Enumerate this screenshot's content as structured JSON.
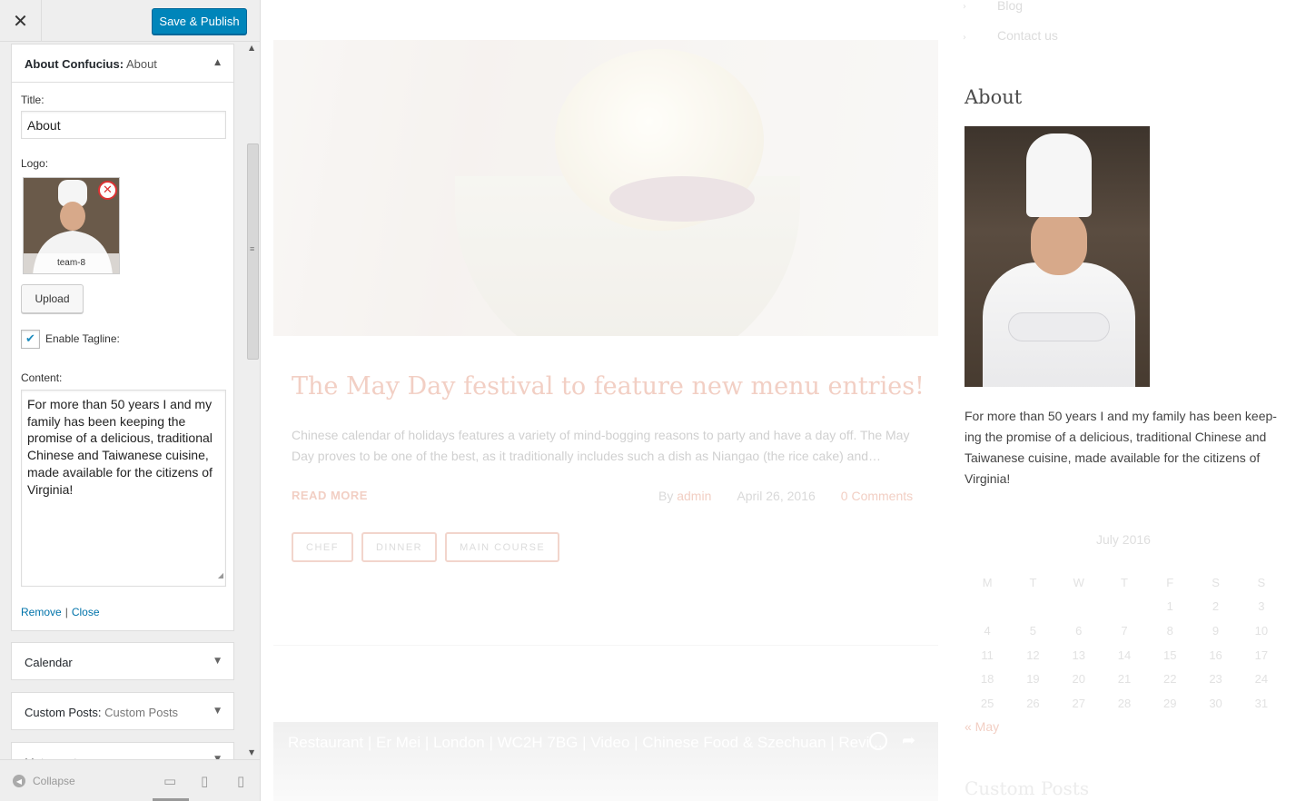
{
  "sidebar": {
    "close_label": "✕",
    "publish_label": "Save & Publish",
    "panel": {
      "title_bold": "About Confucius:",
      "title_sub": " About",
      "title_label": "Title:",
      "title_value": "About",
      "logo_label": "Logo:",
      "logo_caption": "team-8",
      "upload_label": "Upload",
      "tagline_label": "Enable Tagline:",
      "tagline_checked": true,
      "content_label": "Content:",
      "content_value": "For more than 50 years I and my family has been keeping the promise of a delicious, traditional Chinese and Taiwanese cuisine, made available for the citizens of Virginia!",
      "remove_link": "Remove",
      "link_sep": "|",
      "close_link": "Close"
    },
    "sections": [
      {
        "bold": "Calendar",
        "sub": ""
      },
      {
        "bold": "Custom Posts:",
        "sub": " Custom Posts"
      },
      {
        "bold": "Meta: meta",
        "sub": ""
      }
    ],
    "collapse_label": "Collapse"
  },
  "preview": {
    "menu": [
      "Blog",
      "Contact us"
    ],
    "post": {
      "title": "The May Day festival to feature new menu entries!",
      "excerpt": "Chinese calendar of holidays features a variety of mind-bogging reasons to party and have a day off. The May Day proves to be one of the best, as it traditionally includes such a dish as Niangao (the rice cake) and…",
      "read_more": "READ MORE",
      "by": "By",
      "author": "admin",
      "date": "April 26, 2016",
      "comments": "0 Comments",
      "tags": [
        "CHEF",
        "DINNER",
        "MAIN COURSE"
      ]
    },
    "video_title": "Restaurant | Er Mei | London | WC2H 7BG | Video | Chinese Food & Szechuan | Revi...",
    "about": {
      "title": "About",
      "text": "For more than 50 years I and my family has been keep-ing the promise of a delicious, traditional Chinese and Taiwanese cuisine, made available for the citizens of Virginia!"
    },
    "calendar": {
      "caption": "July 2016",
      "weekdays": [
        "M",
        "T",
        "W",
        "T",
        "F",
        "S",
        "S"
      ],
      "weeks": [
        [
          "",
          "",
          "",
          "",
          "1",
          "2",
          "3"
        ],
        [
          "4",
          "5",
          "6",
          "7",
          "8",
          "9",
          "10"
        ],
        [
          "11",
          "12",
          "13",
          "14",
          "15",
          "16",
          "17"
        ],
        [
          "18",
          "19",
          "20",
          "21",
          "22",
          "23",
          "24"
        ],
        [
          "25",
          "26",
          "27",
          "28",
          "29",
          "30",
          "31"
        ]
      ],
      "prev": "« May"
    },
    "custom_posts_title": "Custom Posts"
  }
}
